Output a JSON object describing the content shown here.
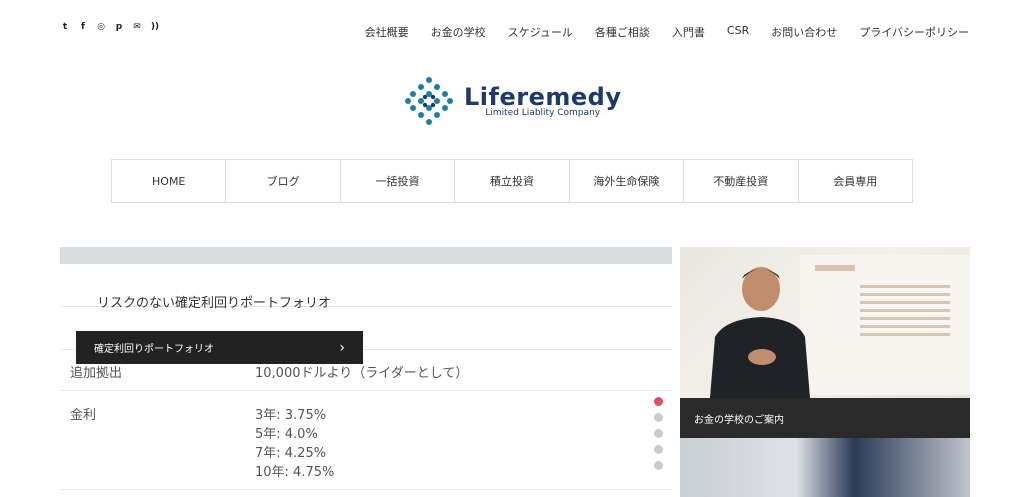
{
  "social": [
    "twitter-icon",
    "facebook-icon",
    "instagram-icon",
    "pinterest-icon",
    "mail-icon",
    "rss-icon"
  ],
  "topnav": [
    "会社概要",
    "お金の学校",
    "スケジュール",
    "各種ご相談",
    "入門書",
    "CSR",
    "お問い合わせ",
    "プライバシーポリシー"
  ],
  "logo": {
    "name": "Liferemedy",
    "sub": "Limited Liablity Company"
  },
  "mainnav": [
    "HOME",
    "ブログ",
    "一括投資",
    "積立投資",
    "海外生命保険",
    "不動産投資",
    "会員専用"
  ],
  "table": {
    "rows": [
      {
        "label": "追加拠出",
        "value": "10,000ドルより（ライダーとして）"
      },
      {
        "label": "金利",
        "values": [
          "3年: 3.75%",
          "5年: 4.0%",
          "7年: 4.25%",
          "10年: 4.75%"
        ]
      }
    ]
  },
  "slider": {
    "caption": "リスクのない確定利回りポートフォリオ",
    "button": "確定利回りポートフォリオ",
    "dots": 5,
    "active": 0
  },
  "side": {
    "caption": "お金の学校のご案内"
  }
}
